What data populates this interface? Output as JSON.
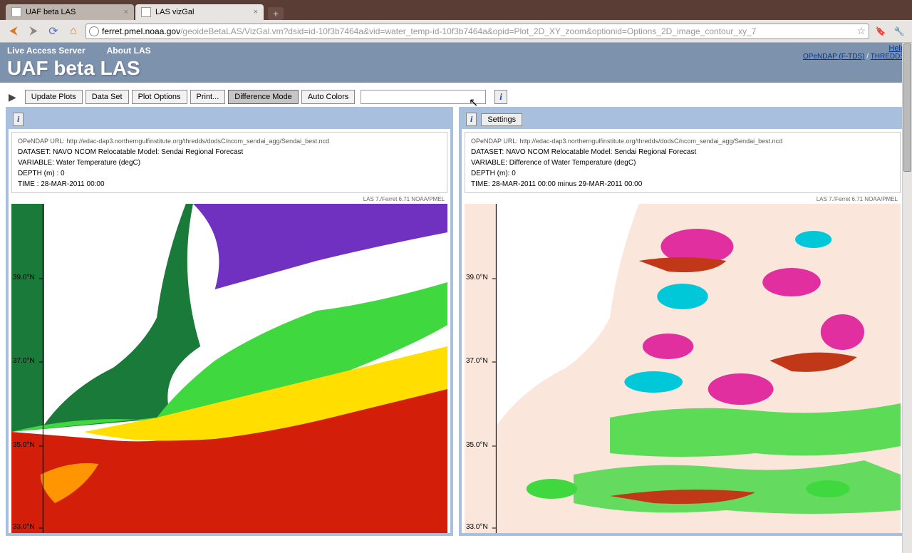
{
  "browser": {
    "tabs": [
      {
        "title": "UAF beta LAS",
        "active": false
      },
      {
        "title": "LAS vizGal",
        "active": true
      }
    ],
    "url_host": "ferret.pmel.noaa.gov",
    "url_path": "/geoideBetaLAS/VizGal.vm?dsid=id-10f3b7464a&vid=water_temp-id-10f3b7464a&opid=Plot_2D_XY_zoom&optionid=Options_2D_image_contour_xy_7"
  },
  "header": {
    "links": {
      "las": "Live Access Server",
      "about": "About LAS"
    },
    "right": {
      "help": "Help",
      "opendap": "OPeNDAP (F-TDS)",
      "sep": " / ",
      "thredds": "THREDDS"
    },
    "title": "UAF beta LAS"
  },
  "toolbar": {
    "update": "Update Plots",
    "dataset": "Data Set",
    "plotopts": "Plot Options",
    "print": "Print...",
    "diffmode": "Difference Mode",
    "autocolors": "Auto Colors",
    "info": "i"
  },
  "panels": {
    "left": {
      "meta_url": "OPeNDAP URL: http://edac-dap3.northerngulfinstitute.org/thredds/dodsC/ncom_sendai_agg/Sendai_best.ncd",
      "dataset": "DATASET: NAVO NCOM Relocatable Model: Sendai Regional Forecast",
      "variable": "VARIABLE: Water Temperature (degC)",
      "depth": "DEPTH (m) : 0",
      "time": "TIME : 28-MAR-2011 00:00",
      "credit": "LAS 7./Ferret 6.71 NOAA/PMEL"
    },
    "right": {
      "settings": "Settings",
      "meta_url": "OPeNDAP URL: http://edac-dap3.northerngulfinstitute.org/thredds/dodsC/ncom_sendai_agg/Sendai_best.ncd",
      "dataset": "DATASET: NAVO NCOM Relocatable Model: Sendai Regional Forecast",
      "variable": "VARIABLE: Difference of Water Temperature (degC)",
      "depth": "DEPTH (m): 0",
      "time": "TIME: 28-MAR-2011 00:00 minus 29-MAR-2011 00:00",
      "credit": "LAS 7./Ferret 6.71 NOAA/PMEL"
    },
    "yticks": [
      "39.0°N",
      "37.0°N",
      "35.0°N",
      "33.0°N"
    ]
  }
}
